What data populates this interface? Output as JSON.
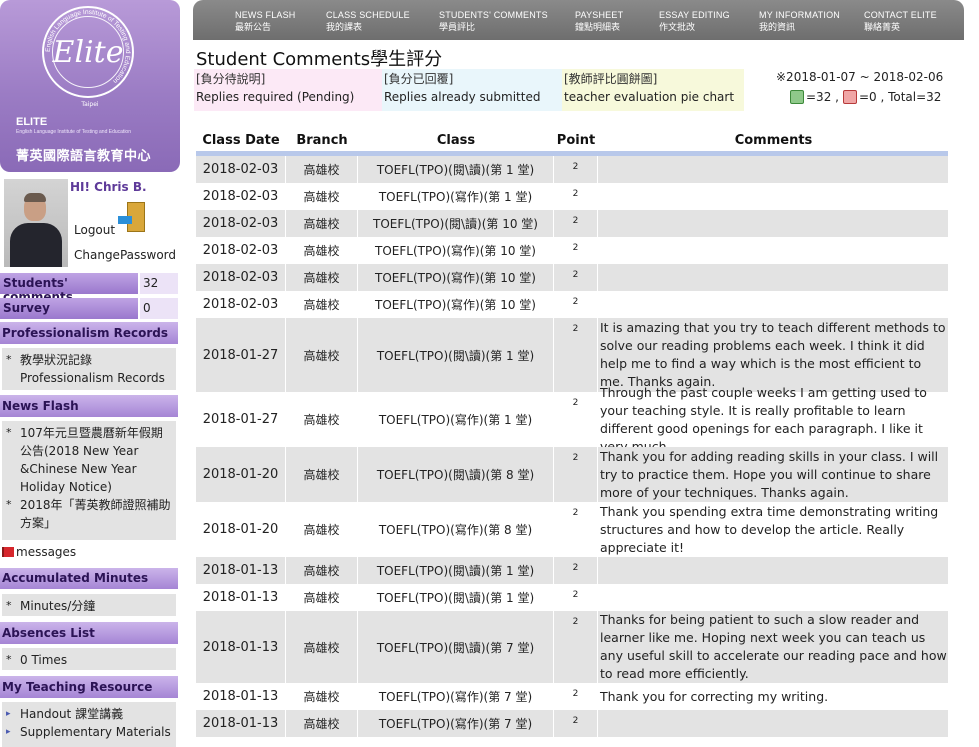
{
  "brand": {
    "logo_text": "Elite",
    "logo_city": "Taipei",
    "logo_ring_text": "English Language Institute of Testing and Education",
    "name_en": "ELITE",
    "sub_en": "English Language Institute of Testing and Education",
    "name_zh": "菁英國際語言教育中心"
  },
  "user": {
    "greeting": "HI! Chris B.",
    "logout_label": "Logout",
    "change_password_label": "ChangePassword"
  },
  "sidebar": {
    "students_comments": {
      "label": "Students' comments",
      "count": "32"
    },
    "survey": {
      "label": "Survey",
      "count": "0"
    },
    "professionalism": {
      "header": "Professionalism Records",
      "items": [
        "教學狀況記錄 Professionalism Records"
      ]
    },
    "news_flash": {
      "header": "News Flash",
      "items": [
        "107年元旦暨農曆新年假期公告(2018 New Year &Chinese New Year Holiday Notice)",
        "2018年「菁英教師證照補助方案」"
      ]
    },
    "messages_label": "messages",
    "accumulated_minutes": {
      "header": "Accumulated Minutes",
      "value": "Minutes/分鐘"
    },
    "absences": {
      "header": "Absences List",
      "value": "0 Times"
    },
    "teaching_resource": {
      "header": "My Teaching Resource",
      "items": [
        "Handout 課堂講義",
        "Supplementary Materials"
      ]
    }
  },
  "nav": [
    {
      "en": "NEWS FLASH",
      "zh": "最新公告"
    },
    {
      "en": "CLASS SCHEDULE",
      "zh": "我的課表"
    },
    {
      "en": "STUDENTS' COMMENTS",
      "zh": "學員評比"
    },
    {
      "en": "PAYSHEET",
      "zh": "鐘點明細表"
    },
    {
      "en": "ESSAY EDITING",
      "zh": "作文批改"
    },
    {
      "en": "MY INFORMATION",
      "zh": "我的資訊"
    },
    {
      "en": "CONTACT ELITE",
      "zh": "聯絡菁英"
    }
  ],
  "page": {
    "title": "Student Comments學生評分",
    "legend": [
      {
        "code": "[負分待說明]",
        "desc": "Replies required (Pending)"
      },
      {
        "code": "[負分已回覆]",
        "desc": "Replies already submitted"
      },
      {
        "code": "[教師評比圓餅圖]",
        "desc": "teacher evaluation pie chart"
      }
    ],
    "date_range": "※2018-01-07 ~ 2018-02-06",
    "positive_count": "=32 ,",
    "negative_count": "=0 , Total=32"
  },
  "table": {
    "headers": [
      "Class Date",
      "Branch",
      "Class",
      "Point",
      "Comments"
    ],
    "rows": [
      {
        "date": "2018-02-03",
        "branch": "高雄校",
        "class": "TOEFL(TPO)(閱\\讀)(第 1 堂)",
        "point": "2",
        "comment": ""
      },
      {
        "date": "2018-02-03",
        "branch": "高雄校",
        "class": "TOEFL(TPO)(寫作)(第 1 堂)",
        "point": "2",
        "comment": ""
      },
      {
        "date": "2018-02-03",
        "branch": "高雄校",
        "class": "TOEFL(TPO)(閱\\讀)(第 10 堂)",
        "point": "2",
        "comment": ""
      },
      {
        "date": "2018-02-03",
        "branch": "高雄校",
        "class": "TOEFL(TPO)(寫作)(第 10 堂)",
        "point": "2",
        "comment": ""
      },
      {
        "date": "2018-02-03",
        "branch": "高雄校",
        "class": "TOEFL(TPO)(寫作)(第 10 堂)",
        "point": "2",
        "comment": ""
      },
      {
        "date": "2018-02-03",
        "branch": "高雄校",
        "class": "TOEFL(TPO)(寫作)(第 10 堂)",
        "point": "2",
        "comment": ""
      },
      {
        "date": "2018-01-27",
        "branch": "高雄校",
        "class": "TOEFL(TPO)(閱\\讀)(第 1 堂)",
        "point": "2",
        "comment": "It is amazing that you try to teach different methods to solve our reading problems each week. I think it did help me to find a way which is the most efficient to me. Thanks again."
      },
      {
        "date": "2018-01-27",
        "branch": "高雄校",
        "class": "TOEFL(TPO)(寫作)(第 1 堂)",
        "point": "2",
        "comment": "Through the past couple weeks I am getting used to your teaching style. It is really profitable to learn different good openings for each paragraph. I like it very much."
      },
      {
        "date": "2018-01-20",
        "branch": "高雄校",
        "class": "TOEFL(TPO)(閱\\讀)(第 8 堂)",
        "point": "2",
        "comment": "Thank you for adding reading skills in your class. I will try to practice them. Hope you will continue to share more of your techniques. Thanks again."
      },
      {
        "date": "2018-01-20",
        "branch": "高雄校",
        "class": "TOEFL(TPO)(寫作)(第 8 堂)",
        "point": "2",
        "comment": "Thank you spending extra time demonstrating writing structures and how to develop the article. Really appreciate it!"
      },
      {
        "date": "2018-01-13",
        "branch": "高雄校",
        "class": "TOEFL(TPO)(閱\\讀)(第 1 堂)",
        "point": "2",
        "comment": ""
      },
      {
        "date": "2018-01-13",
        "branch": "高雄校",
        "class": "TOEFL(TPO)(閱\\讀)(第 1 堂)",
        "point": "2",
        "comment": ""
      },
      {
        "date": "2018-01-13",
        "branch": "高雄校",
        "class": "TOEFL(TPO)(閱\\讀)(第 7 堂)",
        "point": "2",
        "comment": "Thanks for being patient to such a slow reader and learner like me. Hoping next week you can teach us any useful skill to accelerate our reading pace and how to read more efficiently."
      },
      {
        "date": "2018-01-13",
        "branch": "高雄校",
        "class": "TOEFL(TPO)(寫作)(第 7 堂)",
        "point": "2",
        "comment": "Thank you for correcting my writing."
      },
      {
        "date": "2018-01-13",
        "branch": "高雄校",
        "class": "TOEFL(TPO)(寫作)(第 7 堂)",
        "point": "2",
        "comment": ""
      }
    ]
  }
}
